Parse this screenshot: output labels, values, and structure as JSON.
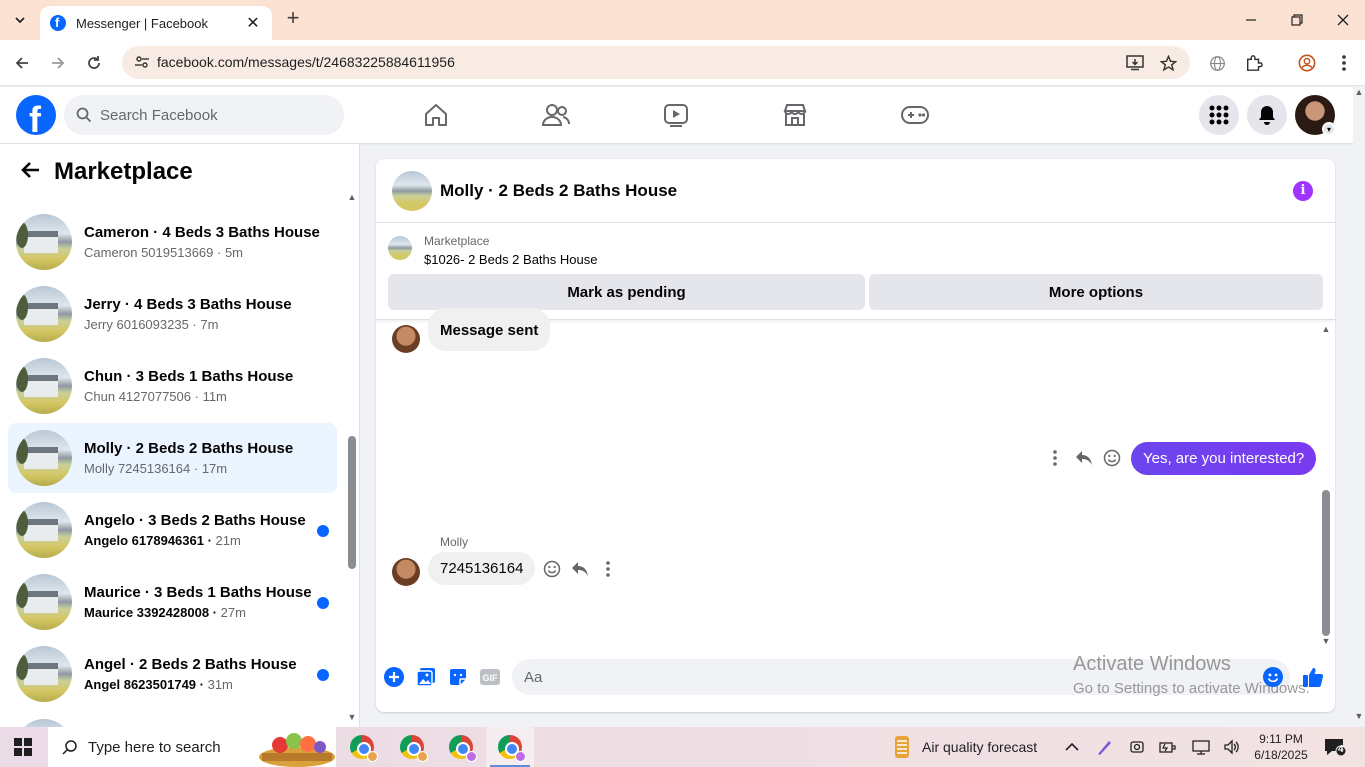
{
  "browser": {
    "tab_title": "Messenger | Facebook",
    "url": "facebook.com/messages/t/24683225884611956"
  },
  "facebook": {
    "search_placeholder": "Search Facebook"
  },
  "sidebar": {
    "title": "Marketplace",
    "conversations": [
      {
        "name": "Cameron · 4 Beds 3 Baths House",
        "preview": "Cameron 5019513669",
        "time": "5m",
        "unread": false,
        "active": false
      },
      {
        "name": "Jerry · 4 Beds 3 Baths House",
        "preview": "Jerry 6016093235",
        "time": "7m",
        "unread": false,
        "active": false
      },
      {
        "name": "Chun · 3 Beds 1 Baths House",
        "preview": "Chun 4127077506",
        "time": "11m",
        "unread": false,
        "active": false
      },
      {
        "name": "Molly · 2 Beds 2 Baths House",
        "preview": "Molly 7245136164",
        "time": "17m",
        "unread": false,
        "active": true
      },
      {
        "name": "Angelo · 3 Beds 2 Baths House",
        "preview": "Angelo 6178946361",
        "time": "21m",
        "unread": true,
        "active": false
      },
      {
        "name": "Maurice · 3 Beds 1 Baths House",
        "preview": "Maurice 3392428008",
        "time": "27m",
        "unread": true,
        "active": false
      },
      {
        "name": "Angel · 2 Beds 2 Baths House",
        "preview": "Angel 8623501749",
        "time": "31m",
        "unread": true,
        "active": false
      }
    ]
  },
  "chat": {
    "title": "Molly · 2 Beds 2 Baths House",
    "marketplace_label": "Marketplace",
    "listing": "$1026- 2 Beds 2 Baths House",
    "mark_pending_label": "Mark as pending",
    "more_options_label": "More options",
    "messages": {
      "first_incoming": "Message sent",
      "outgoing": "Yes, are you interested?",
      "sender_name": "Molly",
      "second_incoming": "7245136164"
    },
    "composer_placeholder": "Aa"
  },
  "watermark": {
    "line1": "Activate Windows",
    "line2": "Go to Settings to activate Windows."
  },
  "taskbar": {
    "search_placeholder": "Type here to search",
    "air_quality": "Air quality forecast",
    "time": "9:11 PM",
    "date": "6/18/2025",
    "notification_count": "4"
  },
  "colors": {
    "fb_blue": "#0866ff",
    "outgoing_bubble": "#6b45ee",
    "info_purple": "#a033ff",
    "tabbar": "#fce2d3"
  }
}
